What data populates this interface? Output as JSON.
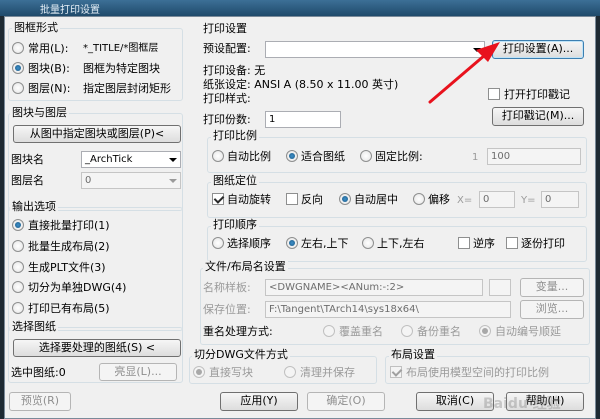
{
  "window": {
    "title": "批量打印设置"
  },
  "frame_style": {
    "title": "图框形式",
    "options": [
      {
        "label": "常用(L):",
        "desc": "*_TITLE/*图框层",
        "selected": false
      },
      {
        "label": "图块(B):",
        "desc": "图框为特定图块",
        "selected": true
      },
      {
        "label": "图层(N):",
        "desc": "指定图层封闭矩形",
        "selected": false
      }
    ]
  },
  "block_layer": {
    "title": "图块与图层",
    "pick_button": "从图中指定图块或图层(P)<",
    "block_name_label": "图块名",
    "block_name_value": "_ArchTick",
    "layer_name_label": "图层名",
    "layer_name_value": "0"
  },
  "output": {
    "title": "输出选项",
    "options": [
      {
        "label": "直接批量打印(1)",
        "selected": true
      },
      {
        "label": "批量生成布局(2)",
        "selected": false
      },
      {
        "label": "生成PLT文件(3)",
        "selected": false
      },
      {
        "label": "切分为单独DWG(4)",
        "selected": false
      },
      {
        "label": "打印已有布局(5)",
        "selected": false
      }
    ]
  },
  "select_drawings": {
    "title": "选择图纸",
    "select_button": "选择要处理的图纸(S) <",
    "selected_count_label": "选中图纸:0",
    "highlight_button": "亮显(L)..."
  },
  "print_settings": {
    "title": "打印设置",
    "preset_label": "预设配置:",
    "preset_value": "",
    "settings_button": "打印设置(A)...",
    "device_line": "打印设备: 无",
    "paper_line": "纸张设定: ANSI A (8.50 x 11.00 英寸)",
    "style_line": "打印样式:",
    "open_stamp_label": "打开打印戳记",
    "stamp_button": "打印戳记(M)...",
    "copies_label": "打印份数:",
    "copies_value": "1"
  },
  "scale": {
    "title": "打印比例",
    "options": [
      {
        "label": "自动比例",
        "selected": false
      },
      {
        "label": "适合图纸",
        "selected": true
      },
      {
        "label": "固定比例:",
        "selected": false
      }
    ],
    "ratio_prefix": "1",
    "ratio_value": "100"
  },
  "positioning": {
    "title": "图纸定位",
    "auto_rotate": "自动旋转",
    "reverse": "反向",
    "auto_center": "自动居中",
    "offset": "偏移",
    "x_label": "X=",
    "x_value": "0",
    "y_label": "Y=",
    "y_value": "0"
  },
  "order": {
    "title": "打印顺序",
    "options": [
      {
        "label": "选择顺序",
        "selected": false
      },
      {
        "label": "左右,上下",
        "selected": true
      },
      {
        "label": "上下,左右",
        "selected": false
      }
    ],
    "reverse_order": "逆序",
    "page_by_page": "逐份打印"
  },
  "file_layout": {
    "title": "文件/布局名设置",
    "name_sample_label": "名称样板:",
    "name_sample_value": "<DWGNAME><ANum:-:2>",
    "variable_button": "变量...",
    "save_location_label": "保存位置:",
    "save_location_value": "F:\\Tangent\\TArch14\\sys18x64\\",
    "browse_button": "浏览...",
    "rename_label": "重名处理方式:",
    "rename_options": [
      {
        "label": "覆盖重名",
        "selected": false
      },
      {
        "label": "备份重名",
        "selected": false
      },
      {
        "label": "自动编号顺延",
        "selected": true
      }
    ]
  },
  "split_dwg": {
    "title": "切分DWG文件方式",
    "options": [
      {
        "label": "直接写块",
        "selected": true
      },
      {
        "label": "清理并保存",
        "selected": false
      }
    ]
  },
  "layout_settings": {
    "title": "布局设置",
    "use_model_space_label": "布局使用模型空间的打印比例"
  },
  "footer": {
    "preview": "预览(R)",
    "apply": "应用(Y)",
    "ok": "确定(O)",
    "cancel": "取消(C)",
    "help": "帮助(H)"
  },
  "watermark_text": "Baidu 经验",
  "colors": {
    "annotation_arrow": "#e8121d",
    "selection_blue": "#2a6bb3"
  }
}
